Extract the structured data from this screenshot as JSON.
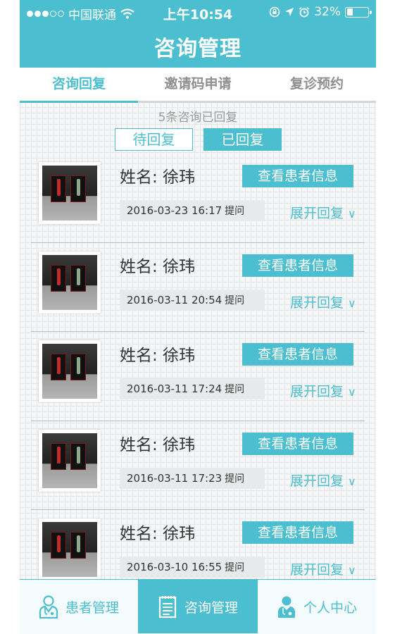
{
  "status_bar": {
    "carrier": "中国联通",
    "time": "上午10:54",
    "battery": "32%",
    "battery_level": 0.32,
    "signal_bars_filled": 3,
    "signal_bars_total": 5
  },
  "header": {
    "title": "咨询管理"
  },
  "tabs": [
    {
      "label": "咨询回复",
      "active": true
    },
    {
      "label": "邀请码申请",
      "active": false
    },
    {
      "label": "复诊预约",
      "active": false
    }
  ],
  "summary": "5条咨询已回复",
  "filters": {
    "pending": "待回复",
    "replied": "已回复",
    "selected": "replied"
  },
  "consultations": [
    {
      "name": "姓名: 徐玮",
      "view_button": "查看患者信息",
      "time": "2016-03-23 16:17",
      "time_suffix": "提问",
      "expand": "展开回复"
    },
    {
      "name": "姓名: 徐玮",
      "view_button": "查看患者信息",
      "time": "2016-03-11 20:54",
      "time_suffix": "提问",
      "expand": "展开回复"
    },
    {
      "name": "姓名: 徐玮",
      "view_button": "查看患者信息",
      "time": "2016-03-11 17:24",
      "time_suffix": "提问",
      "expand": "展开回复"
    },
    {
      "name": "姓名: 徐玮",
      "view_button": "查看患者信息",
      "time": "2016-03-11 17:23",
      "time_suffix": "提问",
      "expand": "展开回复"
    },
    {
      "name": "姓名: 徐玮",
      "view_button": "查看患者信息",
      "time": "2016-03-10 16:55",
      "time_suffix": "提问",
      "expand": "展开回复"
    }
  ],
  "bottom_nav": [
    {
      "label": "患者管理",
      "icon": "doctor-icon",
      "active": false
    },
    {
      "label": "咨询管理",
      "icon": "clipboard-icon",
      "active": true
    },
    {
      "label": "个人中心",
      "icon": "user-profile-icon",
      "active": false
    }
  ],
  "colors": {
    "accent": "#4bbfcf",
    "text": "#333333",
    "muted": "#8f8f8f"
  }
}
